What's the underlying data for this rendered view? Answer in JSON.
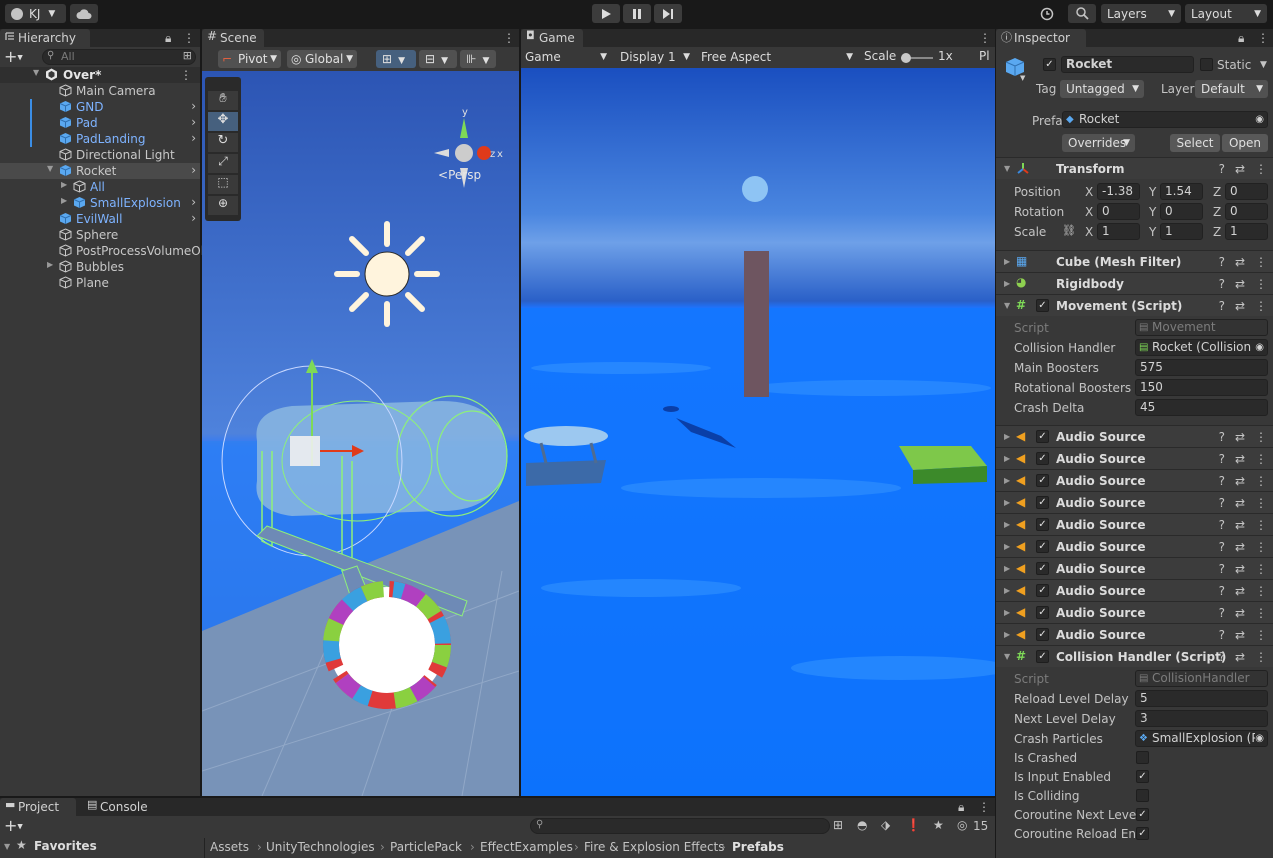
{
  "toolbar": {
    "account": "KJ",
    "layers": "Layers",
    "layout": "Layout"
  },
  "hierarchy": {
    "tab": "Hierarchy",
    "search_placeholder": "All",
    "scene": "Over*",
    "items": [
      {
        "label": "Main Camera",
        "blue": false
      },
      {
        "label": "GND",
        "blue": true
      },
      {
        "label": "Pad",
        "blue": true
      },
      {
        "label": "PadLanding",
        "blue": true
      },
      {
        "label": "Directional Light",
        "blue": false
      },
      {
        "label": "Rocket",
        "blue": false
      },
      {
        "label": "All",
        "blue": true
      },
      {
        "label": "SmallExplosion",
        "blue": true
      },
      {
        "label": "EvilWall",
        "blue": true
      },
      {
        "label": "Sphere",
        "blue": false
      },
      {
        "label": "PostProcessVolumeOl",
        "blue": false
      },
      {
        "label": "Bubbles",
        "blue": false
      },
      {
        "label": "Plane",
        "blue": false
      }
    ]
  },
  "scene": {
    "tab": "Scene",
    "pivot": "Pivot",
    "global": "Global",
    "persp": "Persp",
    "gizmo_y": "y",
    "gizmo_z": "z",
    "gizmo_x": "x"
  },
  "game": {
    "tab": "Game",
    "mode": "Game",
    "display": "Display 1",
    "aspect": "Free Aspect",
    "scale_label": "Scale",
    "scale_value": "1x",
    "trailing": "Pl"
  },
  "inspector": {
    "tab": "Inspector",
    "name": "Rocket",
    "static_label": "Static",
    "tag_label": "Tag",
    "tag_value": "Untagged",
    "layer_label": "Layer",
    "layer_value": "Default",
    "prefab_label": "Prefab",
    "prefab_value": "Rocket",
    "overrides": "Overrides",
    "select": "Select",
    "open": "Open",
    "transform": {
      "title": "Transform",
      "position_label": "Position",
      "rotation_label": "Rotation",
      "scale_label": "Scale",
      "x": "X",
      "y": "Y",
      "z": "Z",
      "position": [
        "-1.38",
        "1.54",
        "0"
      ],
      "rotation": [
        "0",
        "0",
        "0"
      ],
      "scale": [
        "1",
        "1",
        "1"
      ]
    },
    "mesh_filter": "Cube (Mesh Filter)",
    "rigidbody": "Rigidbody",
    "movement": {
      "title": "Movement (Script)",
      "script_label": "Script",
      "script_value": "Movement",
      "collision_label": "Collision Handler",
      "collision_value": "Rocket (Collision I",
      "main_label": "Main Boosters",
      "main_value": "575",
      "rot_label": "Rotational Boosters",
      "rot_value": "150",
      "crash_label": "Crash Delta",
      "crash_value": "45"
    },
    "audio_sources": [
      "Audio Source",
      "Audio Source",
      "Audio Source",
      "Audio Source",
      "Audio Source",
      "Audio Source",
      "Audio Source",
      "Audio Source",
      "Audio Source",
      "Audio Source"
    ],
    "collision": {
      "title": "Collision Handler (Script)",
      "script_label": "Script",
      "script_value": "CollisionHandler",
      "reload_label": "Reload Level Delay",
      "reload_value": "5",
      "next_label": "Next Level Delay",
      "next_value": "3",
      "particles_label": "Crash Particles",
      "particles_value": "SmallExplosion (P",
      "crashed_label": "Is Crashed",
      "input_label": "Is Input Enabled",
      "colliding_label": "Is Colliding",
      "coroutine_next_label": "Coroutine Next Level",
      "coroutine_reload_label": "Coroutine Reload Ena"
    }
  },
  "project": {
    "tab_project": "Project",
    "tab_console": "Console",
    "favorites": "Favorites",
    "hidden_count": "15",
    "breadcrumb": [
      "Assets",
      "UnityTechnologies",
      "ParticlePack",
      "EffectExamples",
      "Fire & Explosion Effects",
      "Prefabs"
    ]
  }
}
